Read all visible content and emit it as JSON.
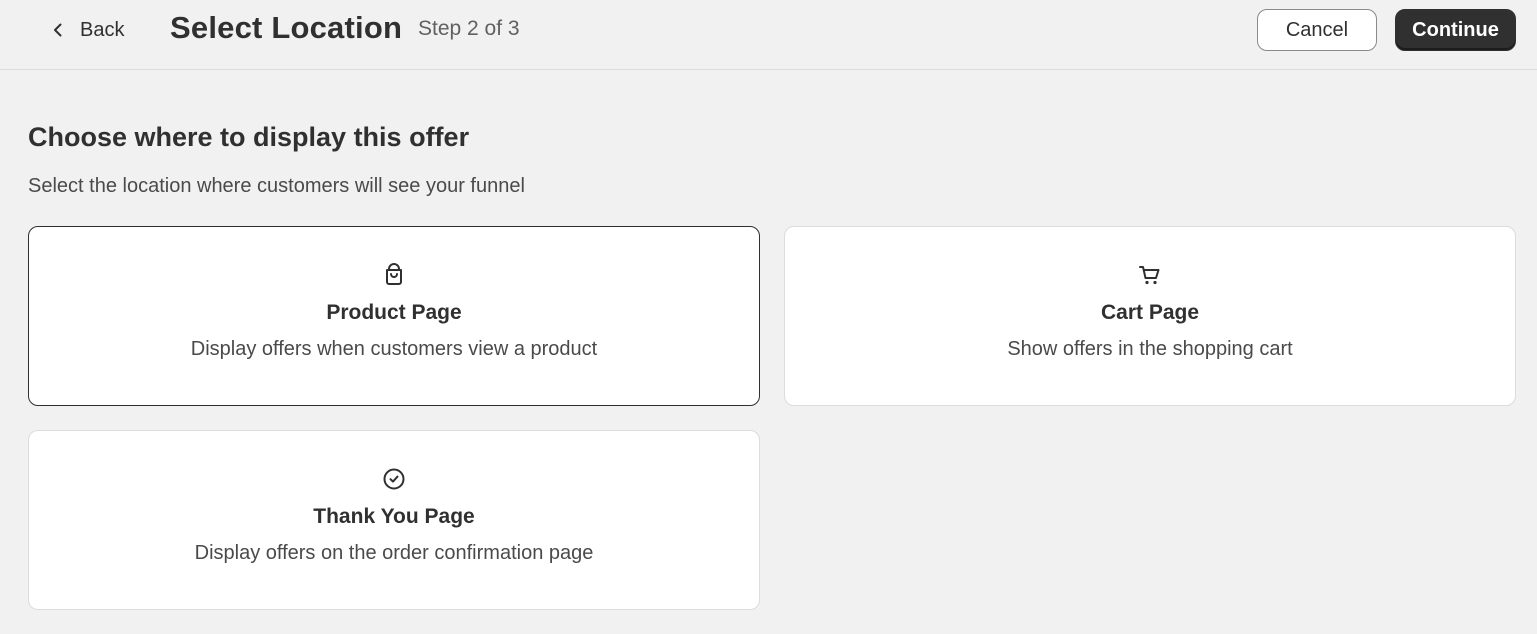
{
  "header": {
    "back_label": "Back",
    "title": "Select Location",
    "step": "Step 2 of 3",
    "cancel_label": "Cancel",
    "continue_label": "Continue"
  },
  "main": {
    "heading": "Choose where to display this offer",
    "subheading": "Select the location where customers will see your funnel"
  },
  "locations": [
    {
      "icon": "shopping-bag-icon",
      "title": "Product Page",
      "description": "Display offers when customers view a product",
      "selected": true
    },
    {
      "icon": "cart-icon",
      "title": "Cart Page",
      "description": "Show offers in the shopping cart",
      "selected": false
    },
    {
      "icon": "check-circle-icon",
      "title": "Thank You Page",
      "description": "Display offers on the order confirmation page",
      "selected": false
    }
  ],
  "colors": {
    "background": "#f1f1f1",
    "card": "#ffffff",
    "primary_button": "#303030",
    "text": "#303030",
    "selected_border": "#303030"
  }
}
